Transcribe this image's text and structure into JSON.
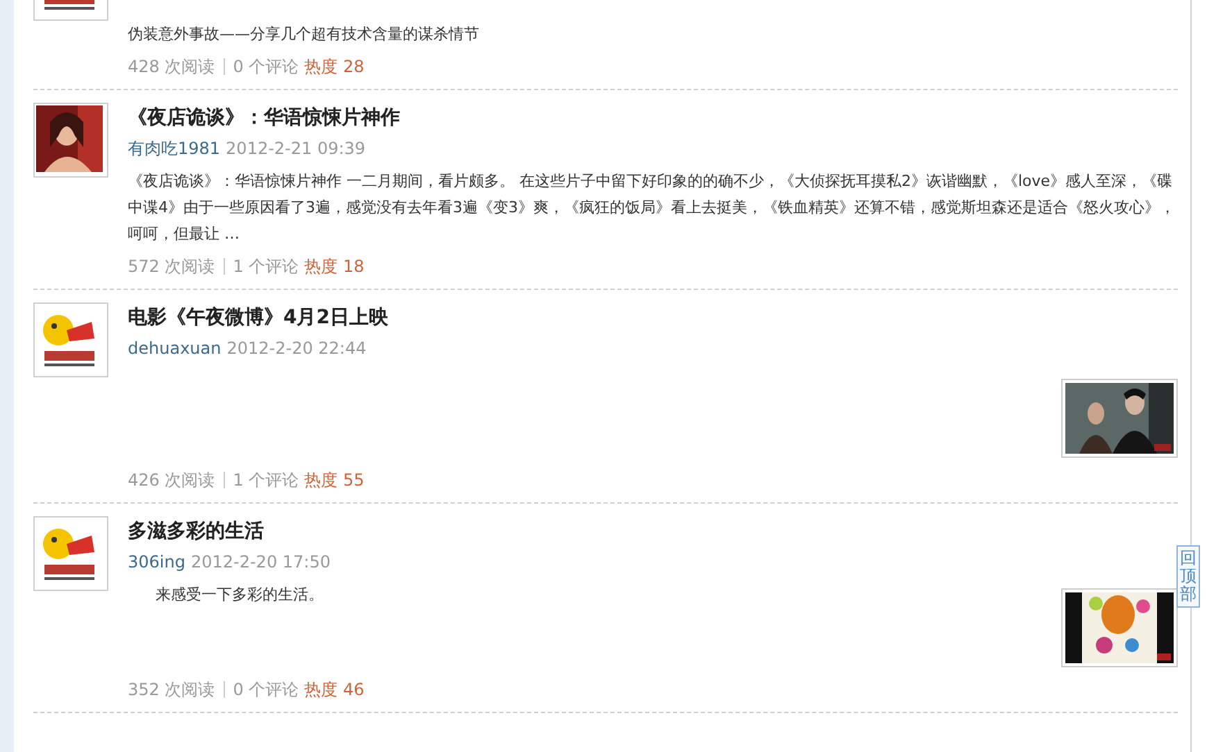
{
  "posts": [
    {
      "summary": "伪装意外事故——分享几个超有技术含量的谋杀情节",
      "stats": {
        "reads": "428 次阅读",
        "comments": "0 个评论",
        "heat": "热度 28"
      }
    },
    {
      "title": "《夜店诡谈》：华语惊悚片神作",
      "author": "有肉吃1981",
      "date": "2012-2-21 09:39",
      "summary": "《夜店诡谈》：华语惊悚片神作 一二月期间，看片颇多。 在这些片子中留下好印象的的确不少，《大侦探抚耳摸私2》诙谐幽默，《love》感人至深，《碟中谍4》由于一些原因看了3遍，感觉没有去年看3遍《变3》爽，《疯狂的饭局》看上去挺美，《铁血精英》还算不错，感觉斯坦森还是适合《怒火攻心》，呵呵，但最让 …",
      "stats": {
        "reads": "572 次阅读",
        "comments": "1 个评论",
        "heat": "热度 18"
      }
    },
    {
      "title": "电影《午夜微博》4月2日上映",
      "author": "dehuaxuan",
      "date": "2012-2-20 22:44",
      "stats": {
        "reads": "426 次阅读",
        "comments": "1 个评论",
        "heat": "热度 55"
      }
    },
    {
      "title": "多滋多彩的生活",
      "author": "306ing",
      "date": "2012-2-20 17:50",
      "summary": "来感受一下多彩的生活。",
      "summary_indent": true,
      "stats": {
        "reads": "352 次阅读",
        "comments": "0 个评论",
        "heat": "热度 46"
      }
    }
  ],
  "back_to_top": "回顶部"
}
